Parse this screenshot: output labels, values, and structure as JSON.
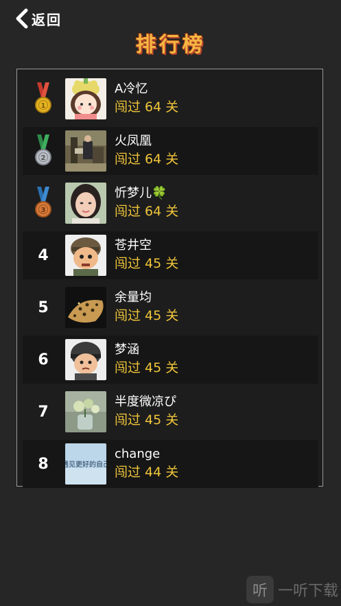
{
  "nav": {
    "back_label": "返回"
  },
  "page": {
    "title": "排行榜"
  },
  "ranking": [
    {
      "rank": "1",
      "name": "A冷忆",
      "score": "闯过 64 关",
      "medal": "gold"
    },
    {
      "rank": "2",
      "name": "火凤凰",
      "score": "闯过 64 关",
      "medal": "silver"
    },
    {
      "rank": "3",
      "name": "忻梦儿🍀",
      "score": "闯过 64 关",
      "medal": "bronze"
    },
    {
      "rank": "4",
      "name": "苍井空",
      "score": "闯过 45 关"
    },
    {
      "rank": "5",
      "name": "余量均",
      "score": "闯过 45 关"
    },
    {
      "rank": "6",
      "name": "梦涵",
      "score": "闯过 45 关"
    },
    {
      "rank": "7",
      "name": "半度微凉ぴ",
      "score": "闯过 45 关"
    },
    {
      "rank": "8",
      "name": "change",
      "score": "闯过 44 关"
    }
  ],
  "avatar_text": {
    "r8": "遇见更好的自己"
  },
  "watermark": {
    "icon": "听",
    "text": "一听下载"
  },
  "colors": {
    "background": "#262626",
    "score": "#f0c53a",
    "title": "#f5b742",
    "gold": "#e6b422",
    "silver": "#b8bcc4",
    "bronze": "#d77a3a"
  }
}
